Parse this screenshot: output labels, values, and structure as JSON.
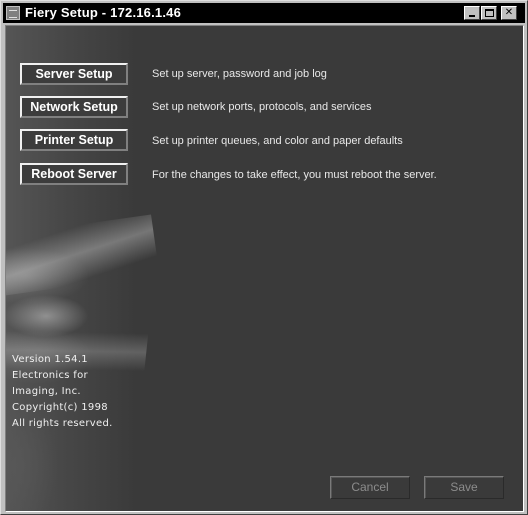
{
  "window": {
    "title": "Fiery Setup - 172.16.1.46",
    "controls": {
      "minimize": "minimize",
      "maximize": "maximize",
      "close": "✕"
    }
  },
  "menu": [
    {
      "label": "Server Setup",
      "description": "Set up server, password and job log"
    },
    {
      "label": "Network Setup",
      "description": "Set up network ports, protocols, and services"
    },
    {
      "label": "Printer Setup",
      "description": "Set up printer queues, and color and paper defaults"
    },
    {
      "label": "Reboot Server",
      "description": "For the changes to take effect, you must reboot the server."
    }
  ],
  "version_info": [
    "Version 1.54.1",
    "Electronics for",
    "Imaging, Inc.",
    "Copyright(c) 1998",
    "All rights reserved."
  ],
  "actions": {
    "cancel_label": "Cancel",
    "save_label": "Save"
  },
  "colors": {
    "titlebar": "#000000",
    "client_bg": "#3a3a3a",
    "text": "#ffffff",
    "disabled_text": "#8c8c8c"
  }
}
